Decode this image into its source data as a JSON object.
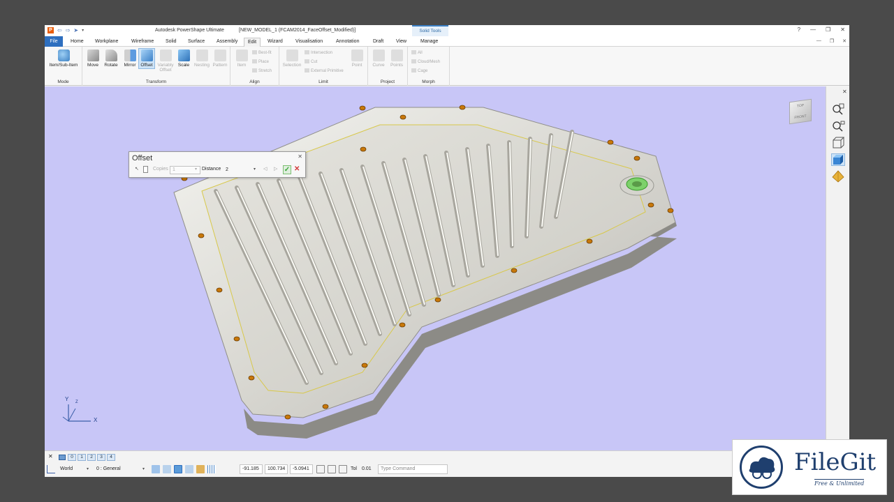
{
  "window": {
    "app_title": "Autodesk PowerShape Ultimate",
    "doc_title": "[NEW_MODEL_1 (FCAM2014_FaceOffset_Modified)]",
    "context_tab": "Solid Tools",
    "app_logo": "P",
    "controls": [
      "?",
      "—",
      "❐",
      "✕"
    ]
  },
  "tabs": {
    "file": "File",
    "items": [
      "Home",
      "Workplane",
      "Wireframe",
      "Solid",
      "Surface",
      "Assembly",
      "Edit",
      "Wizard",
      "Visualisation",
      "Annotation",
      "Draft",
      "View",
      "Manage"
    ],
    "active": "Edit",
    "right_controls": [
      "—",
      "❐",
      "✕"
    ]
  },
  "ribbon": {
    "mode": {
      "label": "Mode",
      "button": "Item/Sub-Item"
    },
    "transform": {
      "label": "Transform",
      "buttons": [
        "Move",
        "Rotate",
        "Mirror",
        "Offset",
        "Variably Offset",
        "Scale",
        "Nesting",
        "Pattern"
      ]
    },
    "align": {
      "label": "Align",
      "button": "Item",
      "small": [
        "Best-fit",
        "Place",
        "Stretch"
      ]
    },
    "limit": {
      "label": "Limit",
      "button": "Selection",
      "small": [
        "Intersection",
        "Cut",
        "External Primitive"
      ],
      "point": "Point"
    },
    "project": {
      "label": "Project",
      "buttons": [
        "Curve",
        "Points"
      ]
    },
    "morph": {
      "label": "Morph",
      "small": [
        "All",
        "Cloud/Mesh",
        "Cage"
      ]
    }
  },
  "viewcube": {
    "top": "TOP",
    "front": "FRONT"
  },
  "axes": {
    "x": "X",
    "y": "Y",
    "z": "Z"
  },
  "offset_dialog": {
    "title": "Offset",
    "copies_label": "Copies",
    "copies_value": "1",
    "distance_label": "Distance",
    "distance_value": "2"
  },
  "status": {
    "levels": [
      "0",
      "1",
      "2",
      "3",
      "4"
    ],
    "workplane": "World",
    "level_field": "0 : General",
    "x": "-91.185",
    "y": "100.734",
    "z": "-5.0941",
    "tol_label": "Tol",
    "tol_value": "0.01",
    "command_placeholder": "Type Command"
  },
  "watermark": {
    "name": "FileGit",
    "tagline": "Free & Unlimited"
  },
  "colors": {
    "viewport_bg": "#c8c6f7",
    "accent": "#2e6fbf",
    "accept": "#3aa83a",
    "cancel": "#d33a3a",
    "hole": "#c8780a"
  }
}
